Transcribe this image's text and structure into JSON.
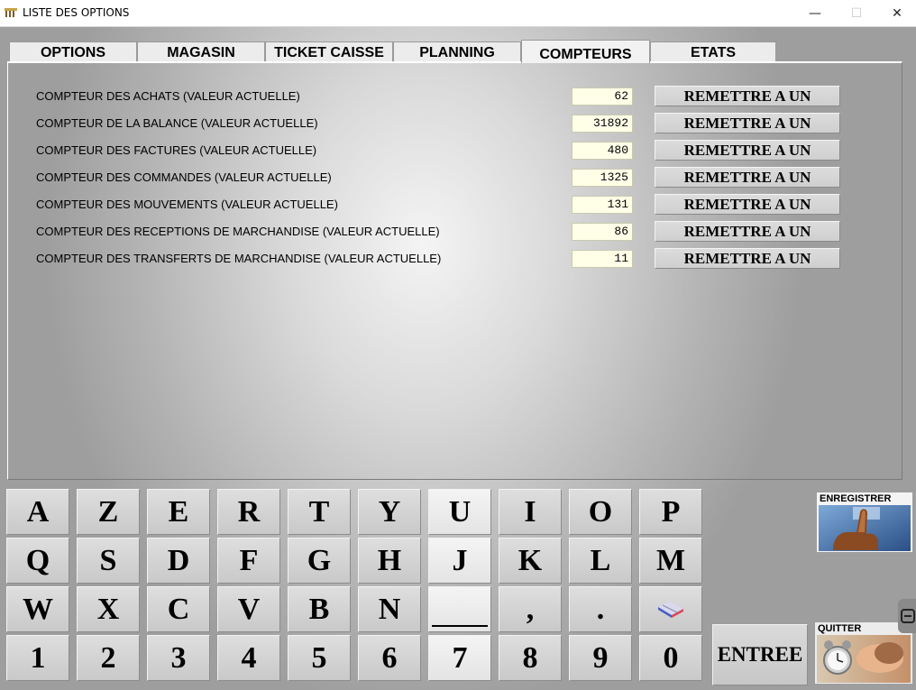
{
  "window": {
    "title": "LISTE DES OPTIONS",
    "minimize": "—",
    "maximize": "☐",
    "close": "✕"
  },
  "tabs": [
    {
      "label": "OPTIONS",
      "active": false
    },
    {
      "label": "MAGASIN",
      "active": false
    },
    {
      "label": "TICKET CAISSE",
      "active": false
    },
    {
      "label": "PLANNING",
      "active": false
    },
    {
      "label": "COMPTEURS",
      "active": true
    },
    {
      "label": "ETATS",
      "active": false
    }
  ],
  "counters": [
    {
      "label": "COMPTEUR DES ACHATS (VALEUR ACTUELLE)",
      "value": "62",
      "button": "REMETTRE A UN"
    },
    {
      "label": "COMPTEUR DE LA BALANCE (VALEUR ACTUELLE)",
      "value": "31892",
      "button": "REMETTRE A UN"
    },
    {
      "label": "COMPTEUR DES FACTURES (VALEUR ACTUELLE)",
      "value": "480",
      "button": "REMETTRE A UN"
    },
    {
      "label": "COMPTEUR DES COMMANDES (VALEUR ACTUELLE)",
      "value": "1325",
      "button": "REMETTRE A UN"
    },
    {
      "label": "COMPTEUR DES MOUVEMENTS (VALEUR ACTUELLE)",
      "value": "131",
      "button": "REMETTRE A UN"
    },
    {
      "label": "COMPTEUR DES RECEPTIONS DE MARCHANDISE (VALEUR ACTUELLE)",
      "value": "86",
      "button": "REMETTRE A UN"
    },
    {
      "label": "COMPTEUR DES TRANSFERTS DE MARCHANDISE (VALEUR ACTUELLE)",
      "value": "11",
      "button": "REMETTRE A UN"
    }
  ],
  "keyboard": {
    "row1": [
      "A",
      "Z",
      "E",
      "R",
      "T",
      "Y",
      "U",
      "I",
      "O",
      "P"
    ],
    "row2": [
      "Q",
      "S",
      "D",
      "F",
      "G",
      "H",
      "J",
      "K",
      "L",
      "M"
    ],
    "row3": [
      "W",
      "X",
      "C",
      "V",
      "B",
      "N",
      "",
      ",",
      ".",
      ""
    ],
    "row4": [
      "1",
      "2",
      "3",
      "4",
      "5",
      "6",
      "7",
      "8",
      "9",
      "0"
    ],
    "space_icon": "underscore-space",
    "erase_icon": "eraser-icon"
  },
  "actions": {
    "enregistrer": "ENREGISTRER",
    "quitter": "QUITTER",
    "entree": "ENTREE"
  }
}
